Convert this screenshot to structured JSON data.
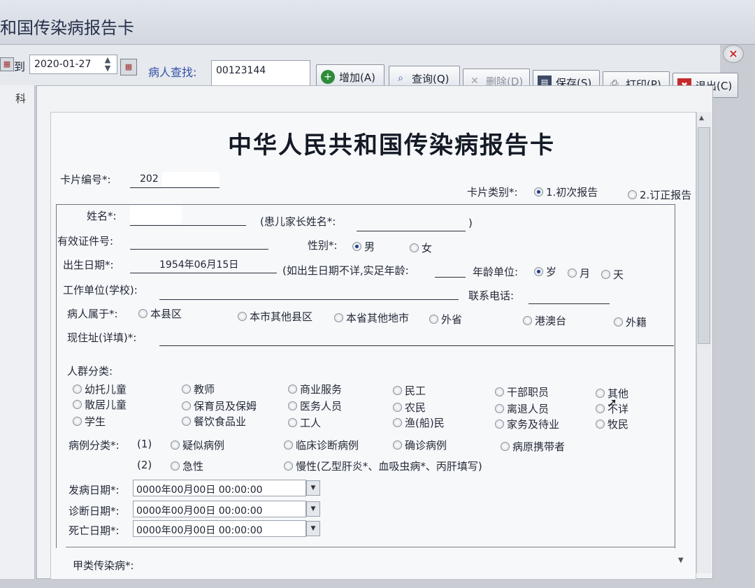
{
  "window": {
    "title": "和国传染病报告卡",
    "close": "×"
  },
  "toolbar": {
    "date_to_label": "到",
    "date_value": "2020-01-27",
    "search_label": "病人查找:",
    "search_value": "00123144",
    "buttons": {
      "add": "增加(A)",
      "query": "查询(Q)",
      "delete": "删除(D)",
      "save": "保存(S)",
      "print": "打印(P)",
      "exit": "退出(C)"
    }
  },
  "left_panel": {
    "label": "科"
  },
  "card": {
    "title": "中华人民共和国传染病报告卡",
    "card_no_label": "卡片编号*:",
    "card_no_value": "202",
    "card_type_label": "卡片类别*:",
    "card_type_opt1": "1.初次报告",
    "card_type_opt2": "2.订正报告",
    "name_label": "姓名*:",
    "guardian_label": "(患儿家长姓名*:",
    "guardian_close": ")",
    "id_label": "有效证件号:",
    "sex_label": "性别*:",
    "sex_male": "男",
    "sex_female": "女",
    "birth_label": "出生日期*:",
    "birth_value": "1954年06月15日",
    "age_note": "(如出生日期不详,实足年龄:",
    "age_unit_label": "年龄单位:",
    "age_unit_year": "岁",
    "age_unit_month": "月",
    "age_unit_day": "天",
    "work_label": "工作单位(学校):",
    "phone_label": "联系电话:",
    "belong_label": "病人属于*:",
    "belong_opts": [
      "本县区",
      "本市其他县区",
      "本省其他地市",
      "外省",
      "港澳台",
      "外籍"
    ],
    "address_label": "现住址(详填)*:",
    "crowd_label": "人群分类:",
    "crowd_rows": [
      [
        "幼托儿童",
        "教师",
        "商业服务",
        "民工",
        "干部职员",
        "其他"
      ],
      [
        "散居儿童",
        "保育员及保姆",
        "医务人员",
        "农民",
        "离退人员",
        "不详"
      ],
      [
        "学生",
        "餐饮食品业",
        "工人",
        "渔(船)民",
        "家务及待业",
        "牧民"
      ]
    ],
    "case_label": "病例分类*:",
    "case_1_tag": "(1)",
    "case_1_opts": [
      "疑似病例",
      "临床诊断病例",
      "确诊病例",
      "病原携带者"
    ],
    "case_2_tag": "(2)",
    "case_2_opts": [
      "急性",
      "慢性(乙型肝炎*、血吸虫病*、丙肝填写)"
    ],
    "onset_label": "发病日期*:",
    "onset_value": "0000年00月00日 00:00:00",
    "diag_label": "诊断日期*:",
    "diag_value": "0000年00月00日 00:00:00",
    "death_label": "死亡日期*:",
    "death_value": "0000年00月00日 00:00:00",
    "class_a_label": "甲类传染病*:"
  }
}
